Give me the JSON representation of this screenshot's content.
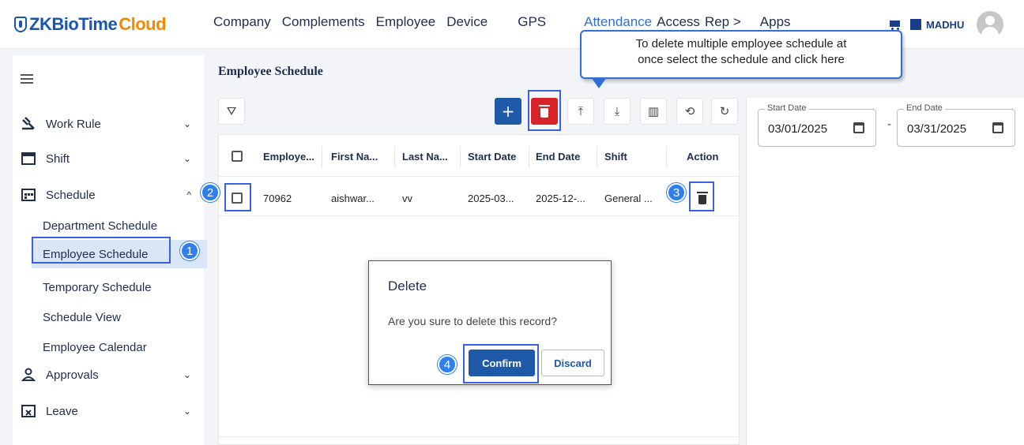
{
  "app": {
    "logo_main": "ZKBioTime",
    "logo_accent": "Cloud",
    "user": "MADHU"
  },
  "nav": [
    "Company",
    "Complements",
    "Employee",
    "Device",
    "GPS",
    "Attendance",
    "Access",
    "Rep  >",
    "Apps"
  ],
  "sidebar": {
    "items": [
      {
        "label": "Work Rule",
        "chevron": "⌄"
      },
      {
        "label": "Shift",
        "chevron": "⌄"
      },
      {
        "label": "Schedule",
        "chevron": "^"
      },
      {
        "label": "Approvals",
        "chevron": "⌄"
      },
      {
        "label": "Leave",
        "chevron": "⌄"
      }
    ],
    "sub_items": [
      "Department Schedule",
      "Employee Schedule",
      "Temporary Schedule",
      "Schedule View",
      "Employee Calendar"
    ]
  },
  "page": {
    "title": "Employee Schedule"
  },
  "table": {
    "headers": [
      "Employe...",
      "First Na...",
      "Last Na...",
      "Start Date",
      "End Date",
      "Shift",
      "Action"
    ],
    "rows": [
      {
        "employee": "70962",
        "first_name": "aishwar...",
        "last_name": "vv",
        "start_date": "2025-03...",
        "end_date": "2025-12-...",
        "shift": "General ..."
      }
    ]
  },
  "filters": {
    "start_label": "Start Date",
    "start_value": "03/01/2025",
    "end_label": "End Date",
    "end_value": "03/31/2025",
    "separator": "-"
  },
  "dialog": {
    "title": "Delete",
    "message": "Are you sure to delete this record?",
    "confirm": "Confirm",
    "discard": "Discard"
  },
  "callout": {
    "line1": "To delete multiple employee schedule at",
    "line2": "once select the schedule and click here"
  },
  "badges": [
    "1",
    "2",
    "3",
    "4"
  ],
  "toolbar_glyphs": {
    "filter": "⛛",
    "add": "+",
    "upload": "⤒",
    "download": "⤓",
    "columns": "▥",
    "history": "⟲",
    "refresh": "↻"
  },
  "colors": {
    "primary": "#1e5aa8",
    "danger": "#d8232a",
    "highlight": "#3a62e0",
    "badge": "#2f80ed",
    "accent": "#f08a00"
  }
}
